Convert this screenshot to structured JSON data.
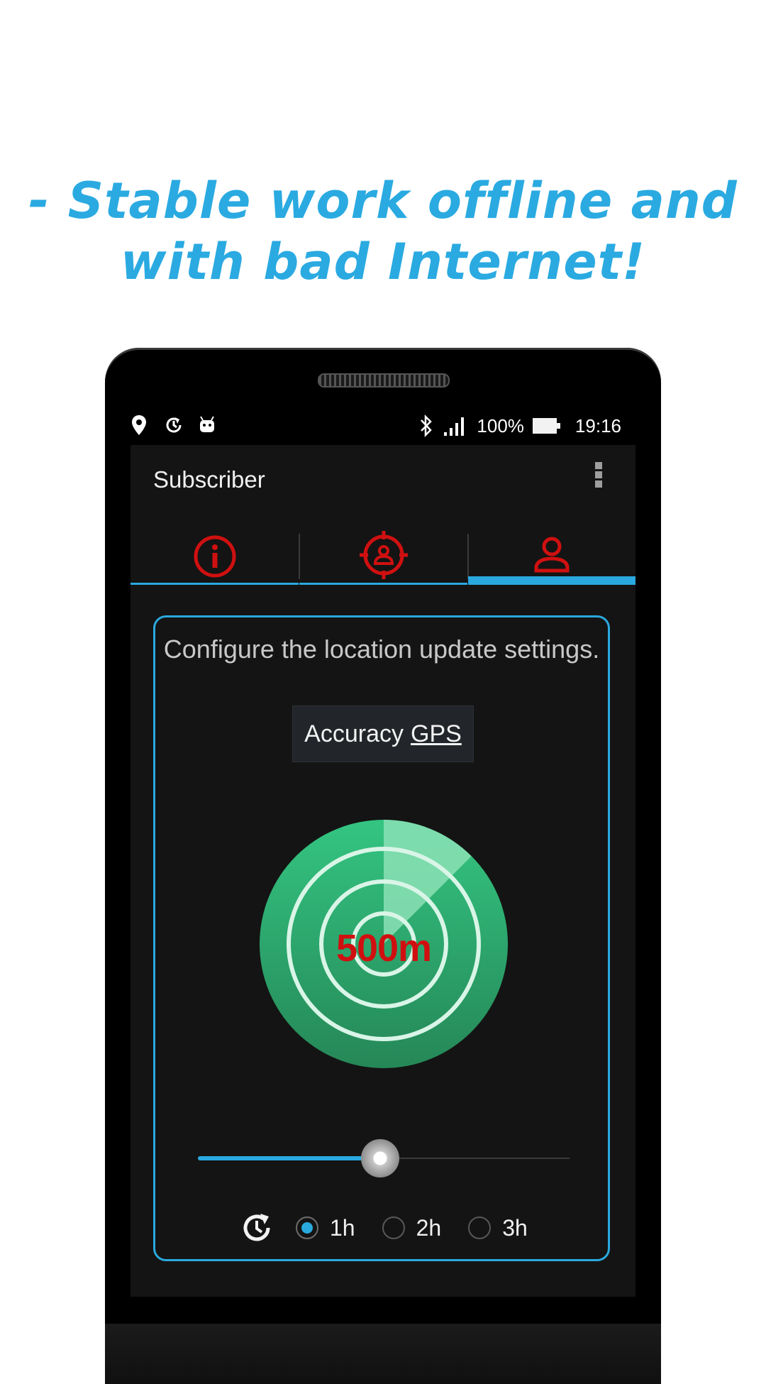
{
  "headline": {
    "line1": "- Stable work offline and",
    "line2": "with bad Internet!"
  },
  "status_bar": {
    "left_icons": [
      "location-pin-icon",
      "sync-clock-icon",
      "android-icon"
    ],
    "right_icons": [
      "bluetooth-icon",
      "signal-icon",
      "battery-icon"
    ],
    "battery_percent": "100%",
    "time": "19:16"
  },
  "app_bar": {
    "title": "Subscriber",
    "menu_icon": "more-vert-icon"
  },
  "tabs": [
    {
      "icon": "info-icon",
      "selected": false
    },
    {
      "icon": "target-person-icon",
      "selected": false
    },
    {
      "icon": "person-icon",
      "selected": true
    }
  ],
  "settings": {
    "description": "Configure the location update settings.",
    "accuracy_label": "Accuracy",
    "accuracy_value": "GPS",
    "radius_label": "500m",
    "slider_fraction": 0.49,
    "interval_icon": "history-icon",
    "interval_options": [
      {
        "label": "1h",
        "checked": true
      },
      {
        "label": "2h",
        "checked": false
      },
      {
        "label": "3h",
        "checked": false
      }
    ]
  },
  "colors": {
    "accent": "#2aa9df",
    "tab_icon": "#d01010",
    "radar_green": "#2fb777",
    "radius_text": "#d01010"
  }
}
